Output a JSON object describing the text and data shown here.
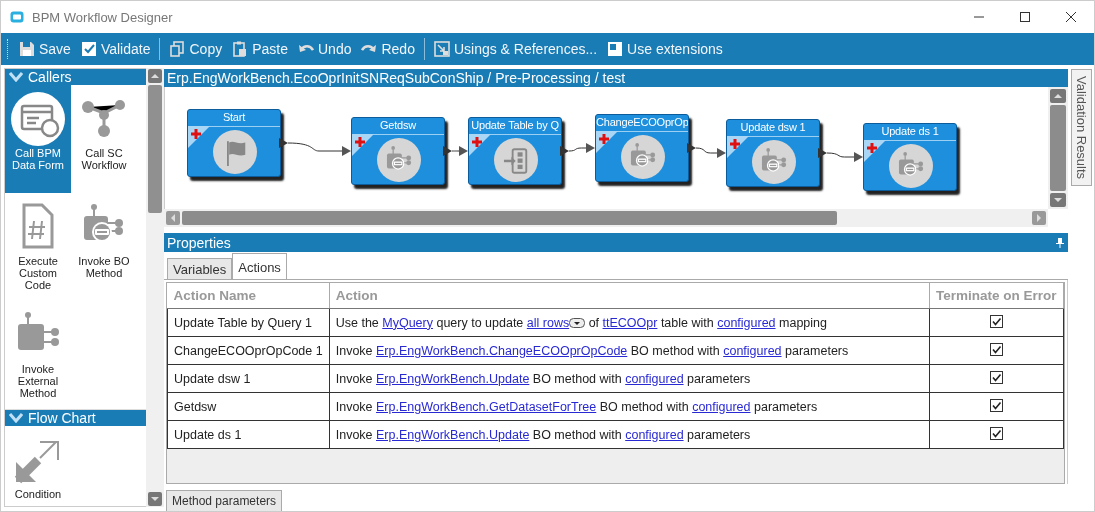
{
  "window": {
    "title": "BPM Workflow Designer"
  },
  "toolbar_groups": [
    [
      {
        "label": "Save"
      },
      {
        "label": "Validate"
      }
    ],
    [
      {
        "label": "Copy"
      },
      {
        "label": "Paste"
      },
      {
        "label": "Undo"
      },
      {
        "label": "Redo"
      }
    ],
    [
      {
        "label": "Usings & References..."
      },
      {
        "label": "Use extensions"
      }
    ]
  ],
  "palette": [
    {
      "title": "Callers",
      "expanded": true,
      "items": [
        {
          "label": "Call BPM Data Form",
          "selected": true
        },
        {
          "label": "Call SC Workflow",
          "selected": false
        },
        {
          "label": "Execute Custom Code",
          "selected": false
        },
        {
          "label": "Invoke BO Method",
          "selected": false
        },
        {
          "label": "Invoke External Method",
          "selected": false
        }
      ]
    },
    {
      "title": "Flow Chart",
      "expanded": true,
      "items": [
        {
          "label": "Condition",
          "selected": false
        }
      ]
    }
  ],
  "breadcrumb": "Erp.EngWorkBench.EcoOprInitSNReqSubConShip / Pre-Processing / test",
  "diagram": {
    "nodes": [
      {
        "label": "Start"
      },
      {
        "label": "Getdsw"
      },
      {
        "label": "Update Table by Q"
      },
      {
        "label": "ChangeECOOprOp"
      },
      {
        "label": "Update dsw 1"
      },
      {
        "label": "Update ds 1"
      }
    ]
  },
  "side_tabs": [
    "Validation Results"
  ],
  "properties": {
    "title": "Properties",
    "tabs": [
      {
        "label": "Variables",
        "selected": false
      },
      {
        "label": "Actions",
        "selected": true
      }
    ],
    "columns": [
      "Action Name",
      "Action",
      "Terminate on Error"
    ],
    "rows": [
      {
        "name": "Update Table by Query 1",
        "action": [
          {
            "kind": "text",
            "text": "Use the "
          },
          {
            "kind": "link",
            "text": "MyQuery"
          },
          {
            "kind": "text",
            "text": " query to update "
          },
          {
            "kind": "dropdown",
            "text": "all rows"
          },
          {
            "kind": "text",
            "text": " of "
          },
          {
            "kind": "link",
            "text": "ttECOOpr"
          },
          {
            "kind": "text",
            "text": " table with "
          },
          {
            "kind": "link",
            "text": "configured"
          },
          {
            "kind": "text",
            "text": " mapping"
          }
        ],
        "terminate_on_error": true
      },
      {
        "name": "ChangeECOOprOpCode 1",
        "action": [
          {
            "kind": "text",
            "text": "Invoke "
          },
          {
            "kind": "link",
            "text": "Erp.EngWorkBench.ChangeECOOprOpCode"
          },
          {
            "kind": "text",
            "text": " BO method with "
          },
          {
            "kind": "link",
            "text": "configured"
          },
          {
            "kind": "text",
            "text": " parameters"
          }
        ],
        "terminate_on_error": true
      },
      {
        "name": "Update dsw 1",
        "action": [
          {
            "kind": "text",
            "text": "Invoke "
          },
          {
            "kind": "link",
            "text": "Erp.EngWorkBench.Update"
          },
          {
            "kind": "text",
            "text": " BO method with "
          },
          {
            "kind": "link",
            "text": "configured"
          },
          {
            "kind": "text",
            "text": " parameters"
          }
        ],
        "terminate_on_error": true
      },
      {
        "name": "Getdsw",
        "action": [
          {
            "kind": "text",
            "text": "Invoke "
          },
          {
            "kind": "link",
            "text": "Erp.EngWorkBench.GetDatasetForTree"
          },
          {
            "kind": "text",
            "text": " BO method with "
          },
          {
            "kind": "link",
            "text": "configured"
          },
          {
            "kind": "text",
            "text": " parameters"
          }
        ],
        "terminate_on_error": true
      },
      {
        "name": "Update ds 1",
        "action": [
          {
            "kind": "text",
            "text": "Invoke "
          },
          {
            "kind": "link",
            "text": "Erp.EngWorkBench.Update"
          },
          {
            "kind": "text",
            "text": " BO method with "
          },
          {
            "kind": "link",
            "text": "configured"
          },
          {
            "kind": "text",
            "text": " parameters"
          }
        ],
        "terminate_on_error": true
      }
    ],
    "bottom_tabs": [
      "Method parameters"
    ]
  }
}
